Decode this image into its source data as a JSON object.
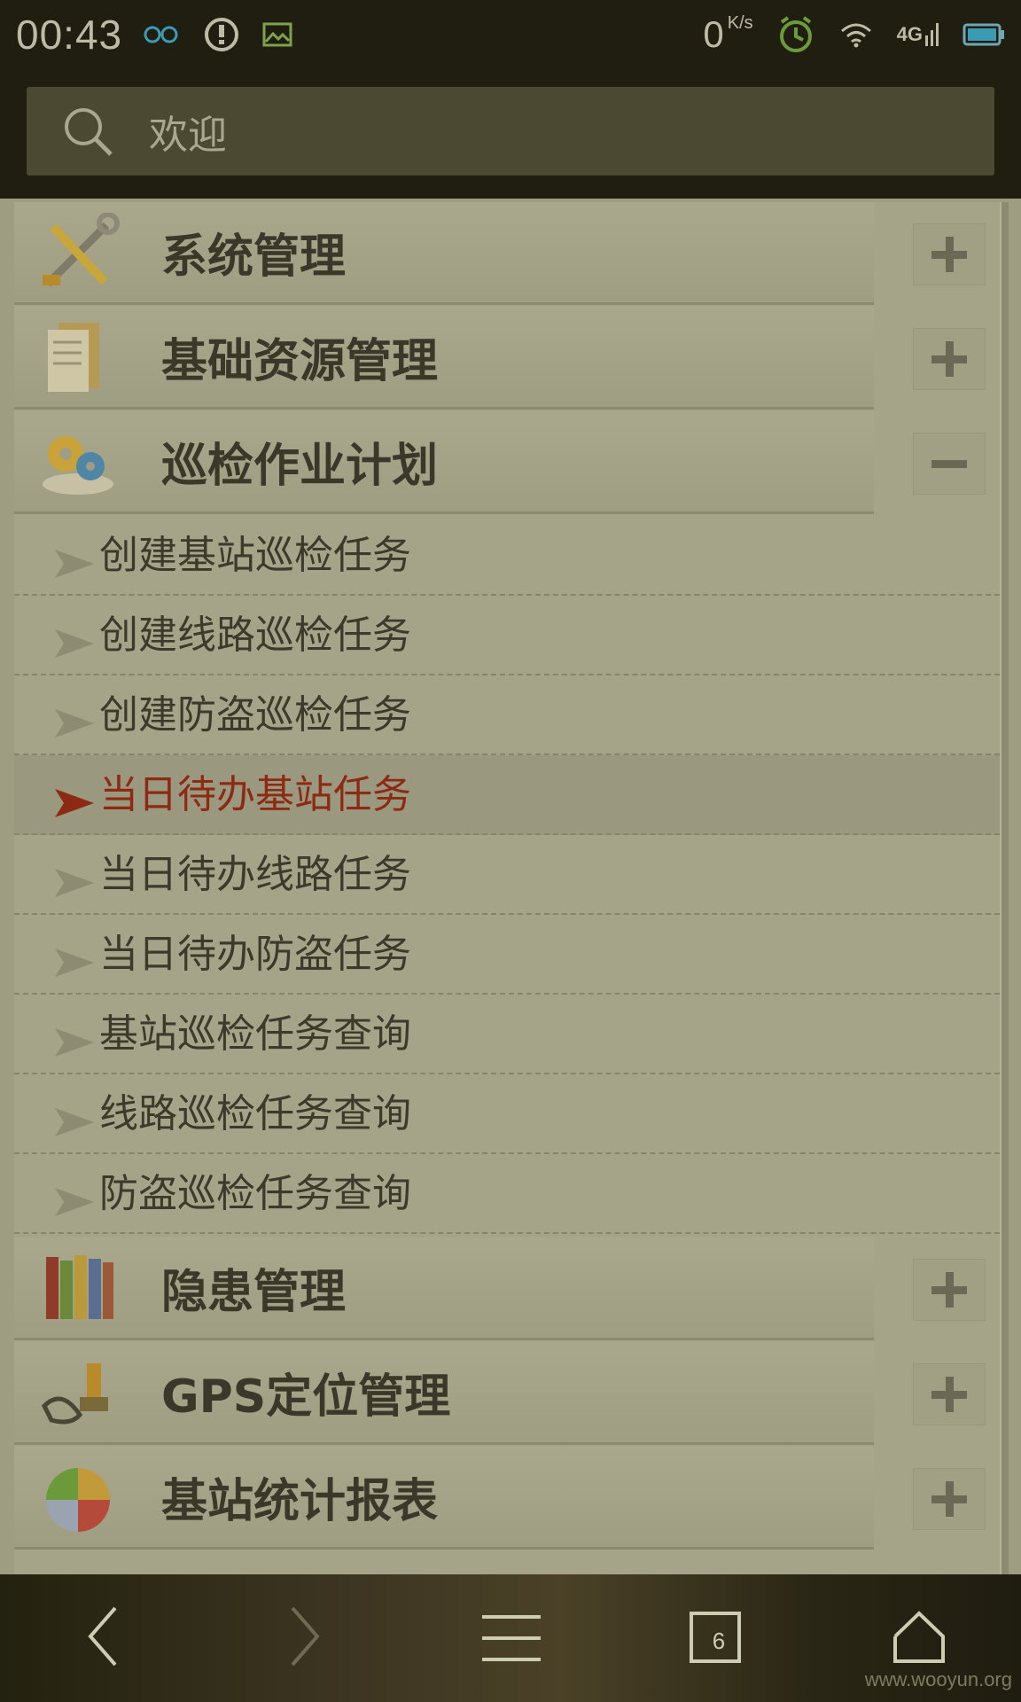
{
  "status_bar": {
    "time": "00:43",
    "speed_value": "0",
    "speed_unit": "K/s",
    "network_label": "4G",
    "icons": [
      "infinity-icon",
      "alert-icon",
      "image-icon",
      "alarm-icon",
      "wifi-icon",
      "signal-icon",
      "battery-icon"
    ]
  },
  "search": {
    "placeholder": "欢迎"
  },
  "menu": {
    "groups": [
      {
        "label": "系统管理",
        "icon": "tools-icon",
        "state": "collapsed"
      },
      {
        "label": "基础资源管理",
        "icon": "document-icon",
        "state": "collapsed"
      },
      {
        "label": "巡检作业计划",
        "icon": "gears-icon",
        "state": "expanded"
      },
      {
        "label": "隐患管理",
        "icon": "books-icon",
        "state": "collapsed"
      },
      {
        "label": "GPS定位管理",
        "icon": "stamp-icon",
        "state": "collapsed"
      },
      {
        "label": "基站统计报表",
        "icon": "pie-chart-icon",
        "state": "collapsed"
      }
    ],
    "sub_items": [
      {
        "label": "创建基站巡检任务"
      },
      {
        "label": "创建线路巡检任务"
      },
      {
        "label": "创建防盗巡检任务"
      },
      {
        "label": "当日待办基站任务",
        "selected": true
      },
      {
        "label": "当日待办线路任务"
      },
      {
        "label": "当日待办防盗任务"
      },
      {
        "label": "基站巡检任务查询"
      },
      {
        "label": "线路巡检任务查询"
      },
      {
        "label": "防盗巡检任务查询"
      }
    ]
  },
  "nav": {
    "tab_count": "6",
    "watermark": "www.wooyun.org"
  },
  "colors": {
    "selected_text": "#8c2a14",
    "label_text": "#3a3829"
  }
}
